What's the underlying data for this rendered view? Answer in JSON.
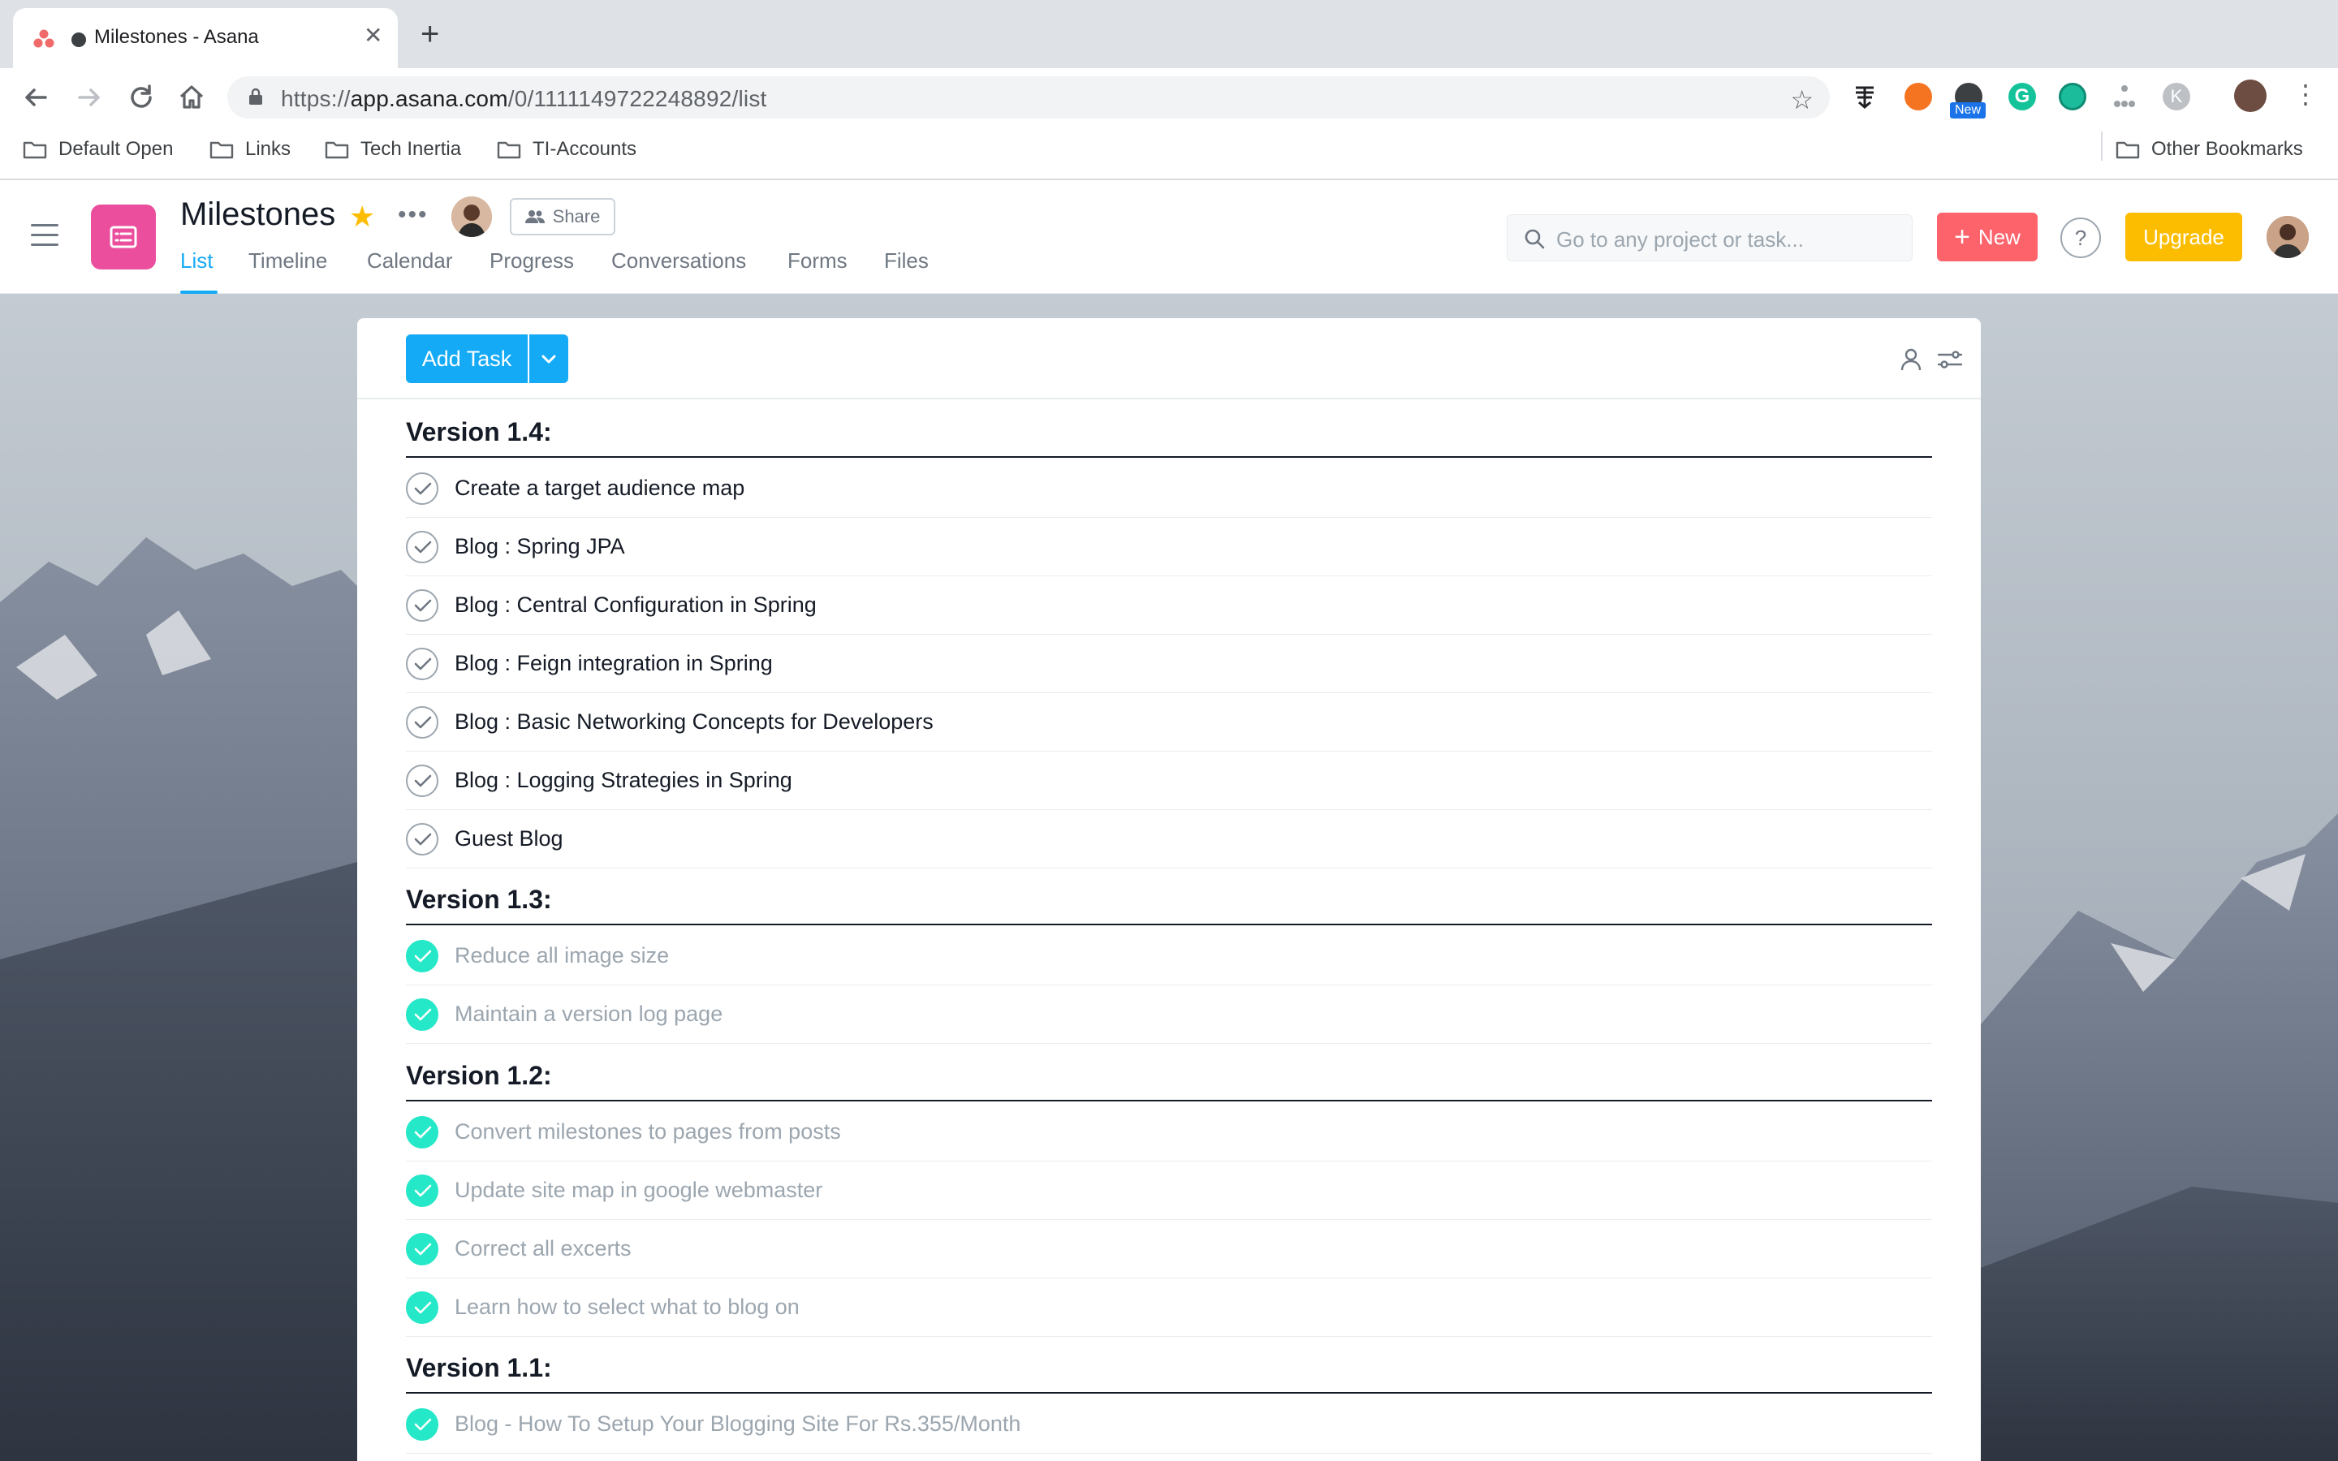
{
  "browser": {
    "tab_title": "Milestones - Asana",
    "url_prefix": "https://",
    "url_host": "app.asana.com",
    "url_path": "/0/1111149722248892/list",
    "new_badge": "New",
    "bookmarks": [
      "Default Open",
      "Links",
      "Tech Inertia",
      "TI-Accounts"
    ],
    "other_bookmarks": "Other Bookmarks"
  },
  "project": {
    "title": "Milestones",
    "share_label": "Share",
    "tabs": [
      "List",
      "Timeline",
      "Calendar",
      "Progress",
      "Conversations",
      "Forms",
      "Files"
    ],
    "active_tab": "List",
    "icon_color": "#ea4e9d"
  },
  "topbar": {
    "search_placeholder": "Go to any project or task...",
    "new_label": "New",
    "help_label": "?",
    "upgrade_label": "Upgrade"
  },
  "list": {
    "add_task_label": "Add Task",
    "sections": [
      {
        "title": "Version 1.4:",
        "tasks": [
          {
            "name": "Create a target audience map",
            "done": false
          },
          {
            "name": "Blog : Spring JPA",
            "done": false
          },
          {
            "name": "Blog : Central Configuration in Spring",
            "done": false
          },
          {
            "name": "Blog : Feign integration in Spring",
            "done": false
          },
          {
            "name": "Blog : Basic Networking Concepts for Developers",
            "done": false
          },
          {
            "name": "Blog : Logging Strategies in Spring",
            "done": false
          },
          {
            "name": "Guest Blog",
            "done": false
          }
        ]
      },
      {
        "title": "Version 1.3:",
        "tasks": [
          {
            "name": "Reduce all image size",
            "done": true
          },
          {
            "name": "Maintain a version log page",
            "done": true
          }
        ]
      },
      {
        "title": "Version 1.2:",
        "tasks": [
          {
            "name": "Convert milestones to pages from posts",
            "done": true
          },
          {
            "name": "Update site map in google webmaster",
            "done": true
          },
          {
            "name": "Correct all excerts",
            "done": true
          },
          {
            "name": "Learn how to select what to blog on",
            "done": true
          }
        ]
      },
      {
        "title": "Version 1.1:",
        "tasks": [
          {
            "name": "Blog - How To Setup Your Blogging Site For Rs.355/Month",
            "done": true
          }
        ]
      }
    ]
  },
  "colors": {
    "accent": "#14aaf5",
    "new_button": "#fc636b",
    "upgrade_button": "#fcbd01",
    "complete_check": "#25e8c8"
  }
}
